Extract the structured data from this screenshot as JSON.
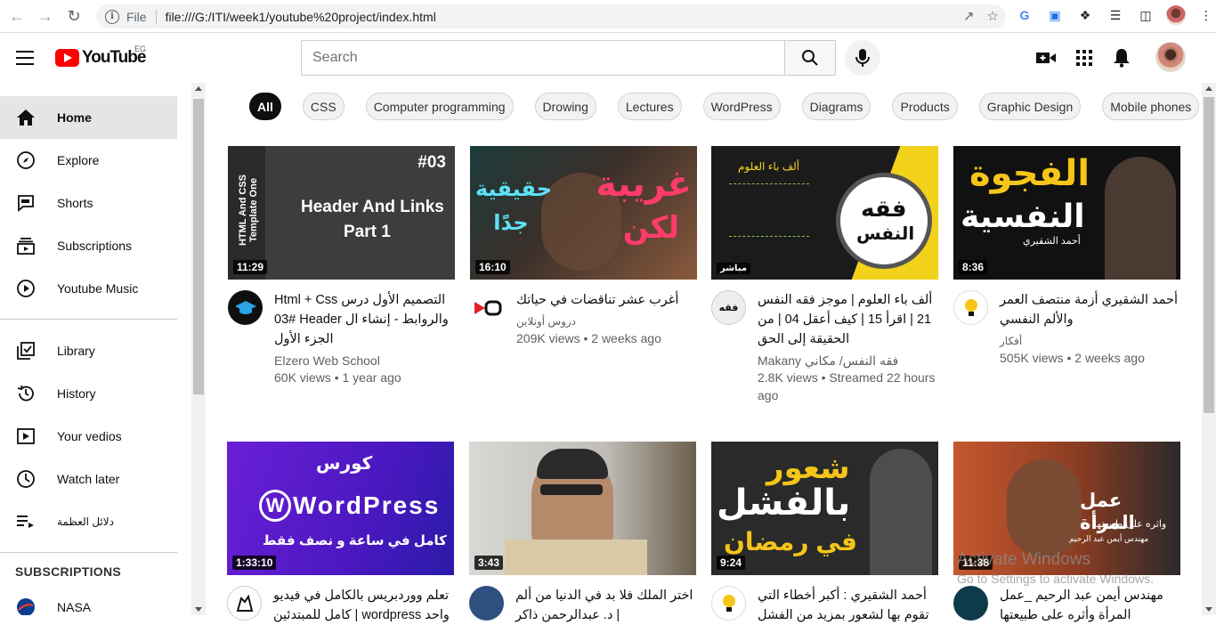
{
  "browser": {
    "protocol_label": "File",
    "url": "file:///G:/ITI/week1/youtube%20project/index.html"
  },
  "header": {
    "logo_text": "YouTube",
    "region": "EG",
    "search_placeholder": "Search"
  },
  "sidebar": {
    "items": [
      {
        "label": "Home",
        "icon": "home-icon"
      },
      {
        "label": "Explore",
        "icon": "compass-icon"
      },
      {
        "label": "Shorts",
        "icon": "shorts-icon"
      },
      {
        "label": "Subscriptions",
        "icon": "subscriptions-icon"
      },
      {
        "label": "Youtube Music",
        "icon": "play-circle-icon"
      },
      {
        "label": "Library",
        "icon": "library-icon"
      },
      {
        "label": "History",
        "icon": "history-icon"
      },
      {
        "label": "Your vedios",
        "icon": "your-videos-icon"
      },
      {
        "label": "Watch later",
        "icon": "clock-icon"
      },
      {
        "label": "دلائل العظمة",
        "icon": "playlist-icon"
      }
    ],
    "subscriptions_heading": "SUBSCRIPTIONS",
    "subscriptions": [
      {
        "label": "NASA"
      }
    ]
  },
  "chips": [
    "All",
    "CSS",
    "Computer programming",
    "Drowing",
    "Lectures",
    "WordPress",
    "Diagrams",
    "Products",
    "Graphic Design",
    "Mobile phones"
  ],
  "videos": [
    {
      "title": "Html + Css التصميم الأول درس #03 Header والروابط - إنشاء ال الجزء الأول",
      "channel": "Elzero Web School",
      "stats": "60K views • 1 year ago",
      "duration": "11:29",
      "thumb_line1": "Header And Links",
      "thumb_line2": "Part 1",
      "thumb_tag": "#03",
      "thumb_side": "HTML And CSS Template One"
    },
    {
      "title": "أغرب عشر تناقضات في حياتك",
      "channel": "دروس أونلاين",
      "stats": "209K views • 2 weeks ago",
      "duration": "16:10",
      "thumb_line1": "غريبة",
      "thumb_line2": "لكن",
      "thumb_line3": "حقيقية جدًا"
    },
    {
      "title": "ألف باء العلوم | موجز فقه النفس 21 | اقرأ 15 | كيف أعقل 04 | من الحقيقة إلى الحق",
      "channel": "Makany فقه النفس/ مكاني",
      "stats": "2.8K views • Streamed 22 hours ago",
      "duration": "مباشر",
      "thumb_line1": "فقه",
      "thumb_line2": "النفس",
      "thumb_small": "ألف باء العلوم"
    },
    {
      "title": "أحمد الشقيري أزمة منتصف العمر والألم النفسي",
      "channel": "أفكار",
      "stats": "505K views • 2 weeks ago",
      "duration": "8:36",
      "thumb_line1": "الفجوة",
      "thumb_line2": "النفسية",
      "thumb_small": "أحمد الشقيري"
    },
    {
      "title": "تعلم ووردبريس بالكامل في فيديو واحد wordpress | كامل للمبتدئين",
      "channel": "",
      "stats": "",
      "duration": "1:33:10",
      "thumb_line1": "كورس",
      "thumb_line2": "WordPress",
      "thumb_line3": "كامل في ساعة و نصف فقط"
    },
    {
      "title": "اختر الملك فلا بد في الدنيا من ألم | د. عبدالرحمن ذاكر",
      "channel": "",
      "stats": "",
      "duration": "3:43"
    },
    {
      "title": "أحمد الشقيري : أكبر أخطاء التي تقوم بها لشعور بمزيد من الفشل",
      "channel": "",
      "stats": "",
      "duration": "9:24",
      "thumb_line1": "شعور",
      "thumb_line2": "بالفشل",
      "thumb_line3": "في رمضان"
    },
    {
      "title": "مهندس أيمن عبد الرحيم _عمل المرأة وأثره على طبيعتها",
      "channel": "",
      "stats": "",
      "duration": "11:38",
      "thumb_line1": "عمل المرأة",
      "thumb_line2": "واثره على طبيعتها",
      "thumb_small": "مهندس أيمن عبد الرحيم"
    }
  ],
  "watermark": {
    "line1": "Activate Windows",
    "line2": "Go to Settings to activate Windows."
  }
}
